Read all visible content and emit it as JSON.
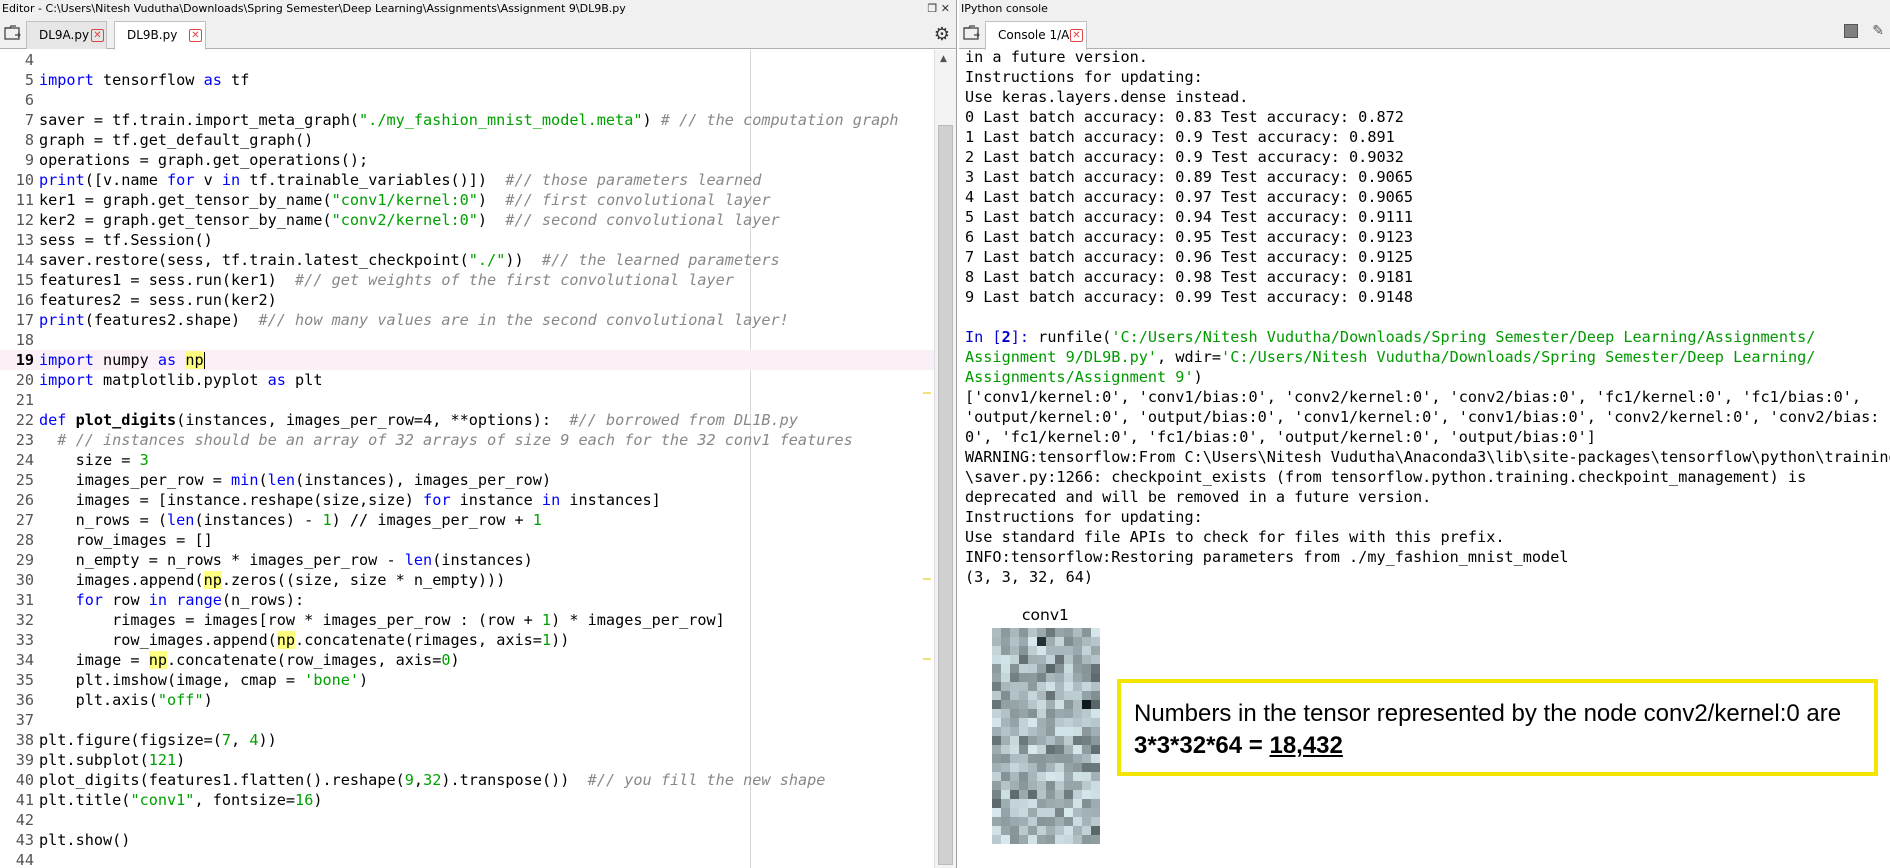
{
  "editor": {
    "title": "Editor - C:\\Users\\Nitesh Vudutha\\Downloads\\Spring Semester\\Deep Learning\\Assignments\\Assignment 9\\DL9B.py",
    "tabs": [
      {
        "label": "DL9A.py"
      },
      {
        "label": "DL9B.py"
      }
    ],
    "lines": [
      {
        "num": "4",
        "parts": [
          [
            "t",
            ""
          ]
        ]
      },
      {
        "num": "5",
        "parts": [
          [
            "kw",
            "import"
          ],
          [
            "t",
            " tensorflow "
          ],
          [
            "kw",
            "as"
          ],
          [
            "t",
            " tf"
          ]
        ]
      },
      {
        "num": "6",
        "parts": [
          [
            "t",
            ""
          ]
        ]
      },
      {
        "num": "7",
        "parts": [
          [
            "t",
            "saver = tf.train.import_meta_graph("
          ],
          [
            "str",
            "\"./my_fashion_mnist_model.meta\""
          ],
          [
            "t",
            ") "
          ],
          [
            "com",
            "# // the computation graph"
          ]
        ]
      },
      {
        "num": "8",
        "parts": [
          [
            "t",
            "graph = tf.get_default_graph()"
          ]
        ]
      },
      {
        "num": "9",
        "parts": [
          [
            "t",
            "operations = graph.get_operations();"
          ]
        ]
      },
      {
        "num": "10",
        "parts": [
          [
            "kw",
            "print"
          ],
          [
            "t",
            "([v.name "
          ],
          [
            "kw",
            "for"
          ],
          [
            "t",
            " v "
          ],
          [
            "kw",
            "in"
          ],
          [
            "t",
            " tf.trainable_variables()])  "
          ],
          [
            "com",
            "#// those parameters learned"
          ]
        ]
      },
      {
        "num": "11",
        "parts": [
          [
            "t",
            "ker1 = graph.get_tensor_by_name("
          ],
          [
            "str",
            "\"conv1/kernel:0\""
          ],
          [
            "t",
            ")  "
          ],
          [
            "com",
            "#// first convolutional layer"
          ]
        ]
      },
      {
        "num": "12",
        "parts": [
          [
            "t",
            "ker2 = graph.get_tensor_by_name("
          ],
          [
            "str",
            "\"conv2/kernel:0\""
          ],
          [
            "t",
            ")  "
          ],
          [
            "com",
            "#// second convolutional layer"
          ]
        ]
      },
      {
        "num": "13",
        "parts": [
          [
            "t",
            "sess = tf.Session()"
          ]
        ]
      },
      {
        "num": "14",
        "parts": [
          [
            "t",
            "saver.restore(sess, tf.train.latest_checkpoint("
          ],
          [
            "str",
            "\"./\""
          ],
          [
            "t",
            "))  "
          ],
          [
            "com",
            "#// the learned parameters"
          ]
        ]
      },
      {
        "num": "15",
        "parts": [
          [
            "t",
            "features1 = sess.run(ker1)  "
          ],
          [
            "com",
            "#// get weights of the first convolutional layer"
          ]
        ]
      },
      {
        "num": "16",
        "parts": [
          [
            "t",
            "features2 = sess.run(ker2)"
          ]
        ]
      },
      {
        "num": "17",
        "parts": [
          [
            "kw",
            "print"
          ],
          [
            "t",
            "(features2.shape)  "
          ],
          [
            "com",
            "#// how many values are in the second convolutional layer!"
          ]
        ]
      },
      {
        "num": "18",
        "parts": [
          [
            "t",
            ""
          ]
        ]
      },
      {
        "num": "19",
        "cur": true,
        "parts": [
          [
            "kw",
            "import"
          ],
          [
            "t",
            " numpy "
          ],
          [
            "kw",
            "as"
          ],
          [
            "t",
            " "
          ],
          [
            "np",
            "np"
          ],
          [
            "cursor",
            ""
          ]
        ]
      },
      {
        "num": "20",
        "parts": [
          [
            "kw",
            "import"
          ],
          [
            "t",
            " matplotlib.pyplot "
          ],
          [
            "kw",
            "as"
          ],
          [
            "t",
            " plt"
          ]
        ]
      },
      {
        "num": "21",
        "parts": [
          [
            "t",
            ""
          ]
        ]
      },
      {
        "num": "22",
        "parts": [
          [
            "kw",
            "def"
          ],
          [
            "t",
            " "
          ],
          [
            "b",
            "plot_digits"
          ],
          [
            "t",
            "(instances, images_per_row=4, **options):  "
          ],
          [
            "com",
            "#// borrowed from DL1B.py"
          ]
        ]
      },
      {
        "num": "23",
        "parts": [
          [
            "t",
            "  "
          ],
          [
            "com",
            "# // instances should be an array of 32 arrays of size 9 each for the 32 conv1 features"
          ]
        ]
      },
      {
        "num": "24",
        "parts": [
          [
            "t",
            "    size = "
          ],
          [
            "str",
            "3"
          ]
        ]
      },
      {
        "num": "25",
        "parts": [
          [
            "t",
            "    images_per_row = "
          ],
          [
            "kw",
            "min"
          ],
          [
            "t",
            "("
          ],
          [
            "kw",
            "len"
          ],
          [
            "t",
            "(instances), images_per_row)"
          ]
        ]
      },
      {
        "num": "26",
        "parts": [
          [
            "t",
            "    images = [instance.reshape(size,size) "
          ],
          [
            "kw",
            "for"
          ],
          [
            "t",
            " instance "
          ],
          [
            "kw",
            "in"
          ],
          [
            "t",
            " instances]"
          ]
        ]
      },
      {
        "num": "27",
        "parts": [
          [
            "t",
            "    n_rows = ("
          ],
          [
            "kw",
            "len"
          ],
          [
            "t",
            "(instances) - "
          ],
          [
            "str",
            "1"
          ],
          [
            "t",
            ") // images_per_row + "
          ],
          [
            "str",
            "1"
          ]
        ]
      },
      {
        "num": "28",
        "parts": [
          [
            "t",
            "    row_images = []"
          ]
        ]
      },
      {
        "num": "29",
        "parts": [
          [
            "t",
            "    n_empty = n_rows * images_per_row - "
          ],
          [
            "kw",
            "len"
          ],
          [
            "t",
            "(instances)"
          ]
        ]
      },
      {
        "num": "30",
        "parts": [
          [
            "t",
            "    images.append("
          ],
          [
            "np",
            "np"
          ],
          [
            "t",
            ".zeros((size, size * n_empty)))"
          ]
        ]
      },
      {
        "num": "31",
        "parts": [
          [
            "t",
            "    "
          ],
          [
            "kw",
            "for"
          ],
          [
            "t",
            " row "
          ],
          [
            "kw",
            "in"
          ],
          [
            "t",
            " "
          ],
          [
            "kw",
            "range"
          ],
          [
            "t",
            "(n_rows):"
          ]
        ]
      },
      {
        "num": "32",
        "parts": [
          [
            "t",
            "        rimages = images[row * images_per_row : (row + "
          ],
          [
            "str",
            "1"
          ],
          [
            "t",
            ") * images_per_row]"
          ]
        ]
      },
      {
        "num": "33",
        "parts": [
          [
            "t",
            "        row_images.append("
          ],
          [
            "np",
            "np"
          ],
          [
            "t",
            ".concatenate(rimages, axis="
          ],
          [
            "str",
            "1"
          ],
          [
            "t",
            "))"
          ]
        ]
      },
      {
        "num": "34",
        "parts": [
          [
            "t",
            "    image = "
          ],
          [
            "np",
            "np"
          ],
          [
            "t",
            ".concatenate(row_images, axis="
          ],
          [
            "str",
            "0"
          ],
          [
            "t",
            ")"
          ]
        ]
      },
      {
        "num": "35",
        "parts": [
          [
            "t",
            "    plt.imshow(image, cmap = "
          ],
          [
            "str",
            "'bone'"
          ],
          [
            "t",
            ")"
          ]
        ]
      },
      {
        "num": "36",
        "parts": [
          [
            "t",
            "    plt.axis("
          ],
          [
            "str",
            "\"off\""
          ],
          [
            "t",
            ")"
          ]
        ]
      },
      {
        "num": "37",
        "parts": [
          [
            "t",
            ""
          ]
        ]
      },
      {
        "num": "38",
        "parts": [
          [
            "t",
            "plt.figure(figsize=("
          ],
          [
            "str",
            "7"
          ],
          [
            "t",
            ", "
          ],
          [
            "str",
            "4"
          ],
          [
            "t",
            "))"
          ]
        ]
      },
      {
        "num": "39",
        "parts": [
          [
            "t",
            "plt.subplot("
          ],
          [
            "str",
            "121"
          ],
          [
            "t",
            ")"
          ]
        ]
      },
      {
        "num": "40",
        "parts": [
          [
            "t",
            "plot_digits(features1.flatten().reshape("
          ],
          [
            "str",
            "9"
          ],
          [
            "t",
            ","
          ],
          [
            "str",
            "32"
          ],
          [
            "t",
            ").transpose())  "
          ],
          [
            "com",
            "#// you fill the new shape"
          ]
        ]
      },
      {
        "num": "41",
        "parts": [
          [
            "t",
            "plt.title("
          ],
          [
            "str",
            "\"conv1\""
          ],
          [
            "t",
            ", fontsize="
          ],
          [
            "str",
            "16"
          ],
          [
            "t",
            ")"
          ]
        ]
      },
      {
        "num": "42",
        "parts": [
          [
            "t",
            ""
          ]
        ]
      },
      {
        "num": "43",
        "parts": [
          [
            "t",
            "plt.show()"
          ]
        ]
      },
      {
        "num": "44",
        "parts": [
          [
            "t",
            ""
          ]
        ]
      }
    ]
  },
  "console": {
    "title": "IPython console",
    "tab_label": "Console 1/A",
    "lines": [
      [
        [
          "t",
          "in a future version."
        ]
      ],
      [
        [
          "t",
          "Instructions for updating:"
        ]
      ],
      [
        [
          "t",
          "Use keras.layers.dense instead."
        ]
      ],
      [
        [
          "t",
          "0 Last batch accuracy: 0.83 Test accuracy: 0.872"
        ]
      ],
      [
        [
          "t",
          "1 Last batch accuracy: 0.9 Test accuracy: 0.891"
        ]
      ],
      [
        [
          "t",
          "2 Last batch accuracy: 0.9 Test accuracy: 0.9032"
        ]
      ],
      [
        [
          "t",
          "3 Last batch accuracy: 0.89 Test accuracy: 0.9065"
        ]
      ],
      [
        [
          "t",
          "4 Last batch accuracy: 0.97 Test accuracy: 0.9065"
        ]
      ],
      [
        [
          "t",
          "5 Last batch accuracy: 0.94 Test accuracy: 0.9111"
        ]
      ],
      [
        [
          "t",
          "6 Last batch accuracy: 0.95 Test accuracy: 0.9123"
        ]
      ],
      [
        [
          "t",
          "7 Last batch accuracy: 0.96 Test accuracy: 0.9125"
        ]
      ],
      [
        [
          "t",
          "8 Last batch accuracy: 0.98 Test accuracy: 0.9181"
        ]
      ],
      [
        [
          "t",
          "9 Last batch accuracy: 0.99 Test accuracy: 0.9148"
        ]
      ],
      [
        [
          "t",
          ""
        ]
      ],
      [
        [
          "in",
          "In ["
        ],
        [
          "num",
          "2"
        ],
        [
          "in",
          "]: "
        ],
        [
          "t",
          "runfile("
        ],
        [
          "g",
          "'C:/Users/Nitesh Vudutha/Downloads/Spring Semester/Deep Learning/Assignments/"
        ]
      ],
      [
        [
          "g",
          "Assignment 9/DL9B.py'"
        ],
        [
          "t",
          ", wdir="
        ],
        [
          "g",
          "'C:/Users/Nitesh Vudutha/Downloads/Spring Semester/Deep Learning/"
        ]
      ],
      [
        [
          "g",
          "Assignments/Assignment 9'"
        ],
        [
          "t",
          ")"
        ]
      ],
      [
        [
          "t",
          "['conv1/kernel:0', 'conv1/bias:0', 'conv2/kernel:0', 'conv2/bias:0', 'fc1/kernel:0', 'fc1/bias:0',"
        ]
      ],
      [
        [
          "t",
          "'output/kernel:0', 'output/bias:0', 'conv1/kernel:0', 'conv1/bias:0', 'conv2/kernel:0', 'conv2/bias:"
        ]
      ],
      [
        [
          "t",
          "0', 'fc1/kernel:0', 'fc1/bias:0', 'output/kernel:0', 'output/bias:0']"
        ]
      ],
      [
        [
          "t",
          "WARNING:tensorflow:From C:\\Users\\Nitesh Vudutha\\Anaconda3\\lib\\site-packages\\tensorflow\\python\\training"
        ]
      ],
      [
        [
          "t",
          "\\saver.py:1266: checkpoint_exists (from tensorflow.python.training.checkpoint_management) is"
        ]
      ],
      [
        [
          "t",
          "deprecated and will be removed in a future version."
        ]
      ],
      [
        [
          "t",
          "Instructions for updating:"
        ]
      ],
      [
        [
          "t",
          "Use standard file APIs to check for files with this prefix."
        ]
      ],
      [
        [
          "t",
          "INFO:tensorflow:Restoring parameters from ./my_fashion_mnist_model"
        ]
      ],
      [
        [
          "t",
          "(3, 3, 32, 64)"
        ]
      ]
    ],
    "plot_title": "conv1"
  },
  "note": {
    "line1": "Numbers in the tensor represented by the node conv2/kernel:0 are",
    "line2_prefix": "3*3*32*64 = ",
    "line2_result": "18,432",
    "border_color": "#f5e400"
  },
  "icons": {
    "browse_tabs": "browse-tabs-icon",
    "close_tab": "close-icon",
    "options": "gear-icon",
    "stop": "stop-icon",
    "clear": "eraser-icon"
  },
  "colors": {
    "keyword": "#0000ff",
    "string": "#00a000",
    "comment": "#888888",
    "highlight": "#ffff80"
  }
}
